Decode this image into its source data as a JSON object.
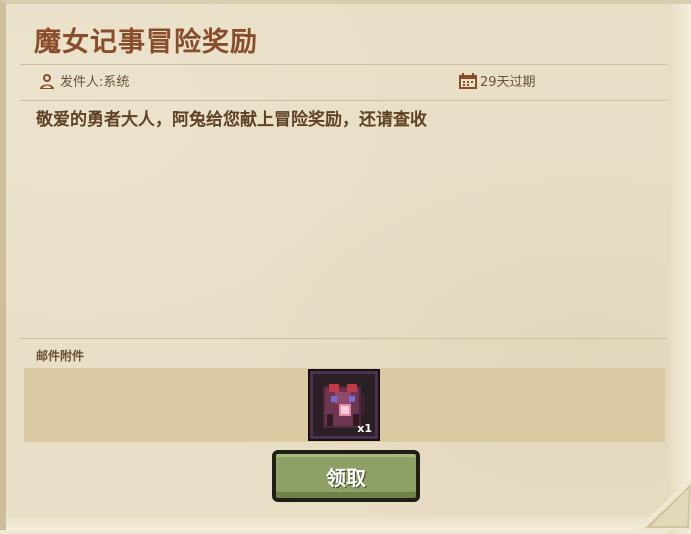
{
  "mail": {
    "title": "魔女记事冒险奖励",
    "sender": "发件人:系统",
    "expiry": "29天过期",
    "body": "敬爱的勇者大人，阿兔给您献上冒险奖励，还请查收",
    "attachments_label": "邮件附件",
    "attachments": [
      {
        "icon": "witch-tome-icon",
        "count": "x1"
      }
    ],
    "claim_label": "领取"
  },
  "colors": {
    "title": "#8a4d2c",
    "paper": "#e9dfc6",
    "button": "#8ea066"
  }
}
